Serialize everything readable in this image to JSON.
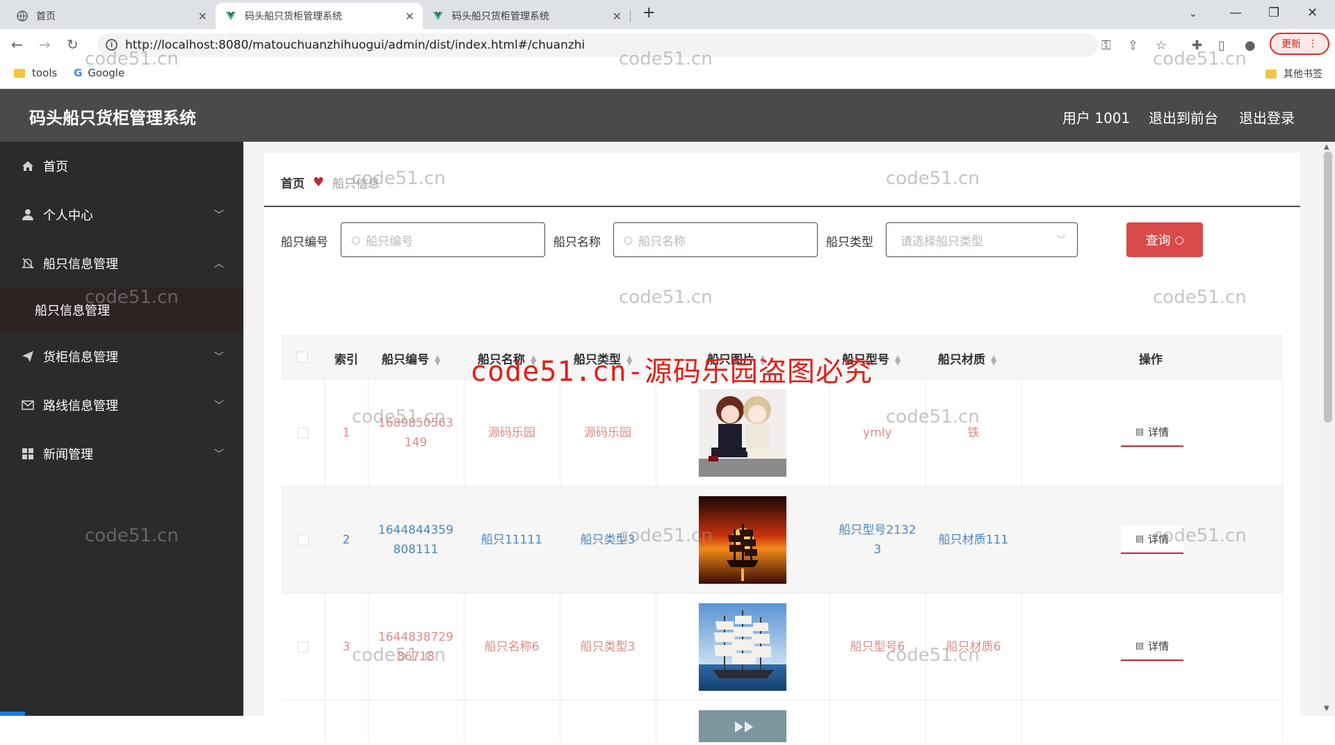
{
  "browser": {
    "tabs": [
      {
        "title": "首页",
        "active": false
      },
      {
        "title": "码头船只货柜管理系统",
        "active": true
      },
      {
        "title": "码头船只货柜管理系统",
        "active": false
      }
    ],
    "url": "http://localhost:8080/matouchuanzhihuogui/admin/dist/index.html#/chuanzhi",
    "update_label": "更新",
    "bookmarks": [
      {
        "label": "tools",
        "icon": "folder-icon"
      },
      {
        "label": "Google",
        "icon": "google-icon"
      }
    ],
    "other_bookmarks": "其他书签"
  },
  "header": {
    "title": "码头船只货柜管理系统",
    "user": "用户 1001",
    "back_to_front": "退出到前台",
    "logout": "退出登录"
  },
  "sidebar": {
    "items": [
      {
        "label": "首页",
        "icon": "home-icon"
      },
      {
        "label": "个人中心",
        "icon": "user-icon"
      },
      {
        "label": "船只信息管理",
        "icon": "bell-off-icon"
      },
      {
        "label": "货柜信息管理",
        "icon": "send-icon"
      },
      {
        "label": "路线信息管理",
        "icon": "mail-icon"
      },
      {
        "label": "新闻管理",
        "icon": "grid-icon"
      }
    ],
    "submenu": {
      "label": "船只信息管理"
    }
  },
  "breadcrumb": {
    "home": "首页",
    "current": "船只信息"
  },
  "search": {
    "number_label": "船只编号",
    "number_placeholder": "船只编号",
    "name_label": "船只名称",
    "name_placeholder": "船只名称",
    "type_label": "船只类型",
    "type_placeholder": "请选择船只类型",
    "query_label": "查询"
  },
  "table": {
    "columns": [
      "索引",
      "船只编号",
      "船只名称",
      "船只类型",
      "船只图片",
      "船只型号",
      "船只材质",
      "操作"
    ],
    "rows": [
      {
        "index": "1",
        "number_l1": "1689850563",
        "number_l2": "149",
        "name": "源码乐园",
        "type": "源码乐园",
        "model_l1": "ymly",
        "model_l2": "",
        "material": "铁",
        "action": "详情",
        "color": "#e08a86"
      },
      {
        "index": "2",
        "number_l1": "1644844359",
        "number_l2": "808111",
        "name": "船只11111",
        "type": "船只类型3",
        "model_l1": "船只型号2132",
        "model_l2": "3",
        "material": "船只材质111",
        "action": "详情",
        "color": "#4a86c0"
      },
      {
        "index": "3",
        "number_l1": "1644838729",
        "number_l2": "86718",
        "name": "船只名称6",
        "type": "船只类型3",
        "model_l1": "船只型号6",
        "model_l2": "",
        "material": "船只材质6",
        "action": "详情",
        "color": "#e08a86"
      }
    ]
  },
  "watermarks": {
    "text": "code51.cn",
    "banner": "code51.cn-源码乐园盗图必究"
  }
}
